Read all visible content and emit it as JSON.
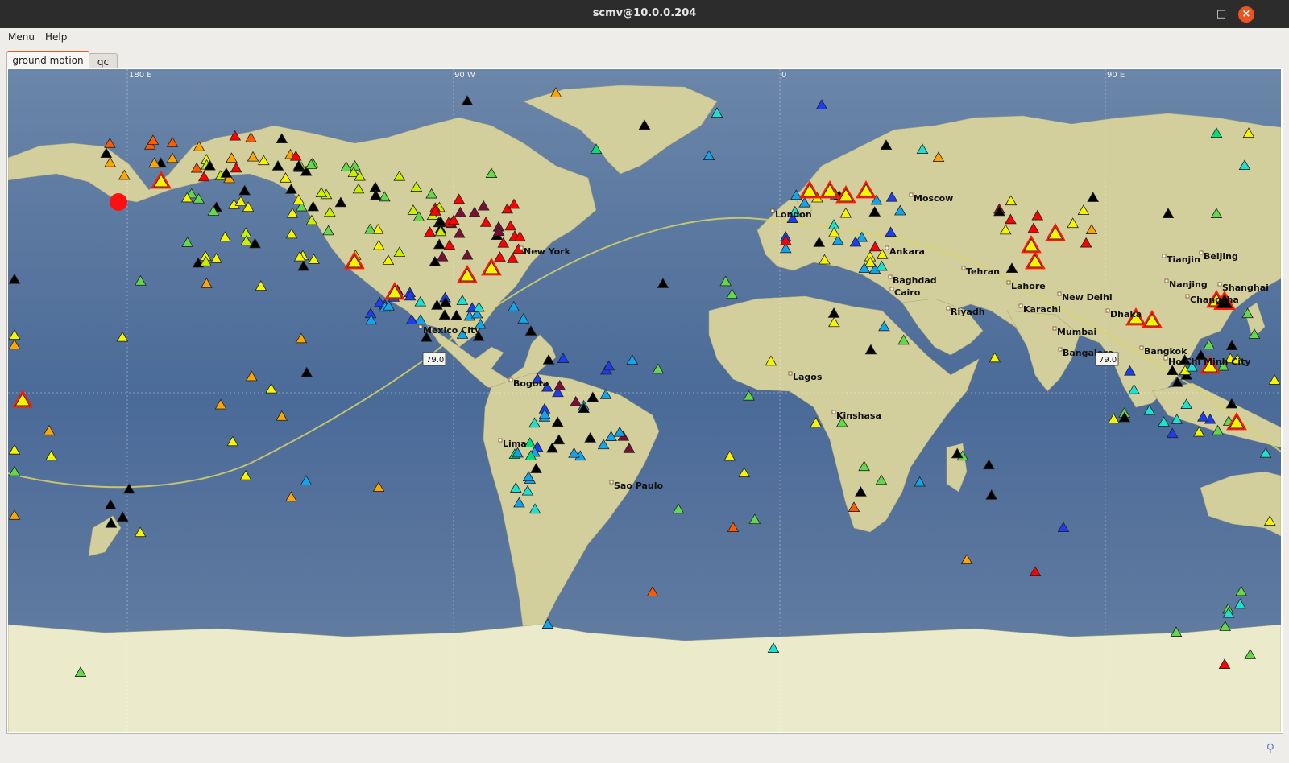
{
  "window": {
    "title": "scmv@10.0.0.204",
    "controls": {
      "minimize": "–",
      "maximize": "□",
      "close": "×"
    }
  },
  "menubar": {
    "items": [
      "Menu",
      "Help"
    ]
  },
  "tabs": [
    {
      "label": "ground motion",
      "active": true
    },
    {
      "label": "qc",
      "active": false
    }
  ],
  "map": {
    "graticule_labels": [
      "180 E",
      "90 W",
      "0",
      "90 E"
    ],
    "cities": [
      "New York",
      "Mexico City",
      "Bogota",
      "Lima",
      "Sao Paulo",
      "London",
      "Moscow",
      "Ankara",
      "Baghdad",
      "Cairo",
      "Tehran",
      "Riyadh",
      "Lahore",
      "New Delhi",
      "Karachi",
      "Mumbai",
      "Bangalore",
      "Lagos",
      "Kinshasa",
      "Tianjin",
      "Beijing",
      "Nanjing",
      "Shanghai",
      "Changsha",
      "Dhaka",
      "Bangkok",
      "Ho Chi Minh City"
    ],
    "distance_labels": [
      "79.0",
      "79.0"
    ],
    "event_marker": "red-circle",
    "colors": {
      "ocean": "#4f6e9a",
      "land": "#d3cf9c",
      "ice": "#ebeacb",
      "great_circle": "#d8d26a",
      "alert": "#ff1a00"
    },
    "station_colors": [
      "#ff0000",
      "#ff5a00",
      "#ffa500",
      "#f5f500",
      "#c8f000",
      "#62d84a",
      "#00e07a",
      "#1ee0d0",
      "#12a5ec",
      "#1d3ef0",
      "#000000",
      "#7a0f35"
    ]
  },
  "statusbar": {
    "icon": "network-status-icon"
  }
}
